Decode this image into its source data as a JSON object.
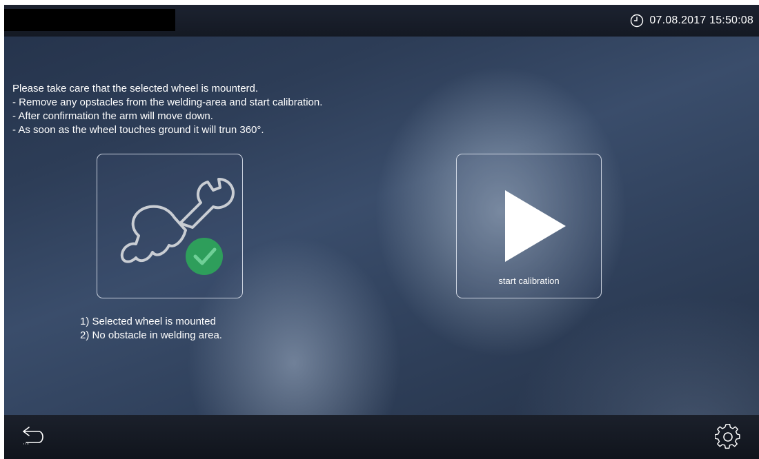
{
  "header": {
    "datetime": "07.08.2017 15:50:08",
    "clock_icon": "clock-icon"
  },
  "instructions": {
    "lines": [
      "Please take care that the selected wheel is mounterd.",
      "- Remove any opstacles from the welding-area and start calibration.",
      "- After confirmation the arm will move down.",
      "- As soon as the wheel touches ground it will trun 360°."
    ]
  },
  "status_tile": {
    "icon": "wheel-mounted-check-icon",
    "check_color": "#2e9e5b"
  },
  "start_tile": {
    "label": "start calibration",
    "icon": "play-icon"
  },
  "checklist": {
    "items": [
      "1) Selected wheel is mounted",
      "2) No obstacle in welding area."
    ]
  },
  "footer": {
    "back_icon": "back-arrow-icon",
    "settings_icon": "gear-icon"
  }
}
